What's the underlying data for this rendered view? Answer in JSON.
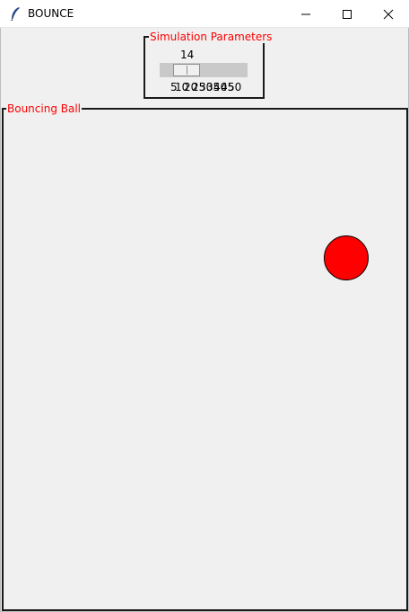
{
  "window": {
    "title": "BOUNCE",
    "controls": [
      "minimize",
      "maximize",
      "close"
    ]
  },
  "params_group": {
    "title": "Simulation Parameters",
    "slider": {
      "value": "14",
      "ticks": [
        "5",
        "10",
        "20",
        "25",
        "30",
        "35",
        "40",
        "45",
        "50"
      ]
    }
  },
  "ball_group": {
    "title": "Bouncing Ball"
  },
  "colors": {
    "group_title": "#ff0000",
    "ball_fill": "#ff0000",
    "ball_outline": "#000000",
    "background": "#f0f0f0"
  },
  "icons": {
    "app": "feather-icon",
    "minimize": "minimize-icon",
    "maximize": "maximize-icon",
    "close": "close-icon"
  }
}
